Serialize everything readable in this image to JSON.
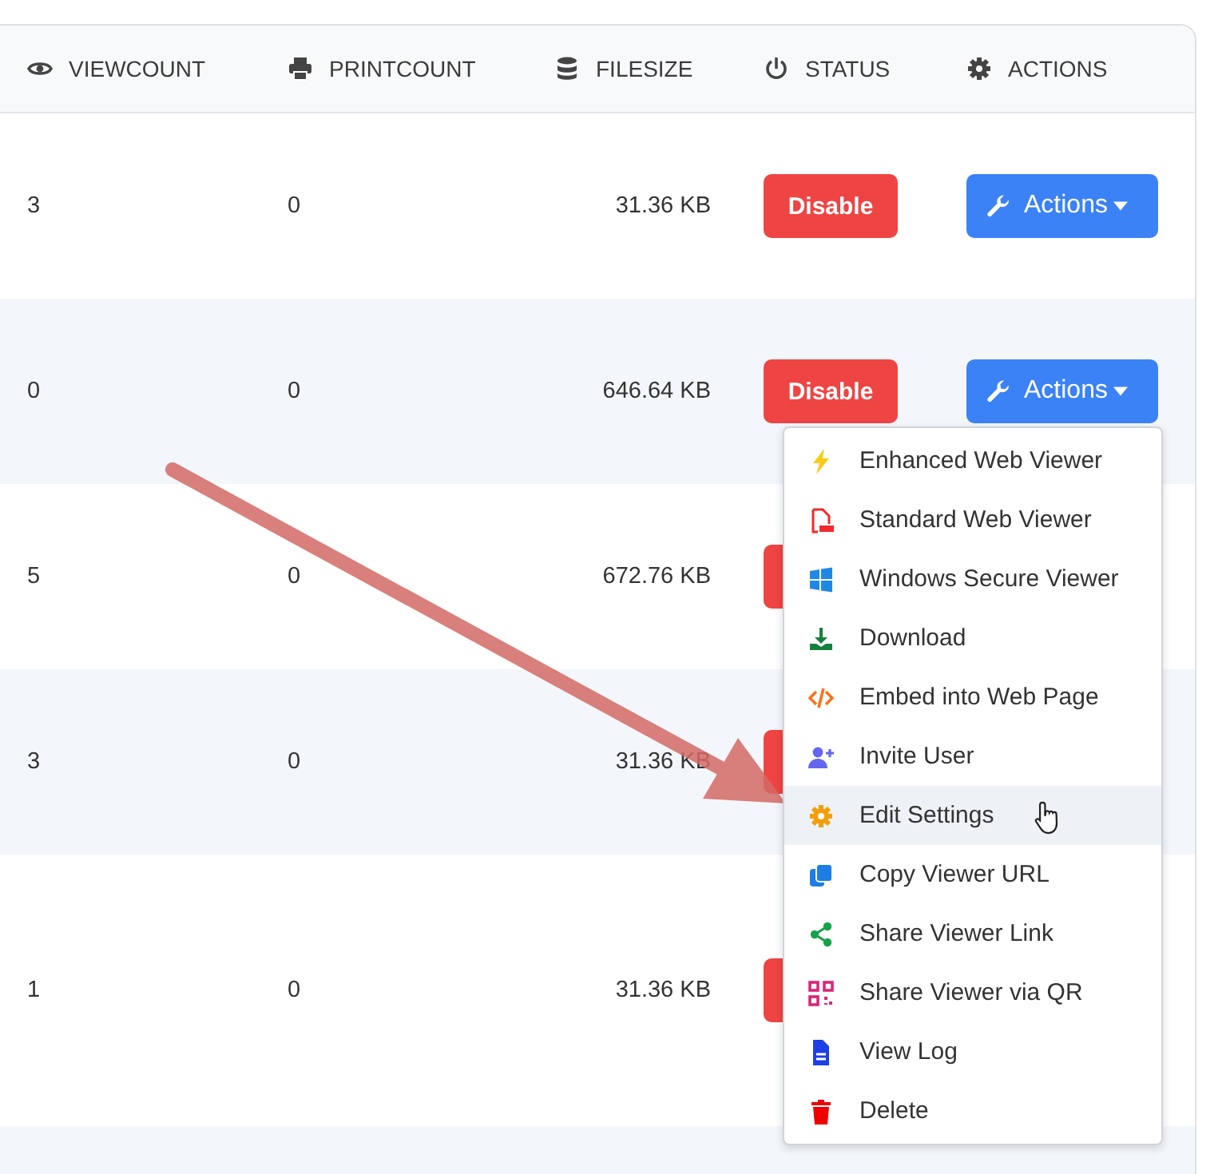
{
  "table": {
    "columns": [
      {
        "label": "VIEWCOUNT"
      },
      {
        "label": "PRINTCOUNT"
      },
      {
        "label": "FILESIZE"
      },
      {
        "label": "STATUS"
      },
      {
        "label": "ACTIONS"
      }
    ],
    "rows": [
      {
        "viewcount": "3",
        "printcount": "0",
        "filesize": "31.36 KB",
        "status": "Disable",
        "actions": "Actions"
      },
      {
        "viewcount": "0",
        "printcount": "0",
        "filesize": "646.64 KB",
        "status": "Disable",
        "actions": "Actions"
      },
      {
        "viewcount": "5",
        "printcount": "0",
        "filesize": "672.76 KB"
      },
      {
        "viewcount": "3",
        "printcount": "0",
        "filesize": "31.36 KB"
      },
      {
        "viewcount": "1",
        "printcount": "0",
        "filesize": "31.36 KB"
      }
    ]
  },
  "actions_menu": {
    "items": [
      {
        "label": "Enhanced Web Viewer",
        "highlighted": false
      },
      {
        "label": "Standard Web Viewer",
        "highlighted": false
      },
      {
        "label": "Windows Secure Viewer",
        "highlighted": false
      },
      {
        "label": "Download",
        "highlighted": false
      },
      {
        "label": "Embed into Web Page",
        "highlighted": false
      },
      {
        "label": "Invite User",
        "highlighted": false
      },
      {
        "label": "Edit Settings",
        "highlighted": true
      },
      {
        "label": "Copy Viewer URL",
        "highlighted": false
      },
      {
        "label": "Share Viewer Link",
        "highlighted": false
      },
      {
        "label": "Share Viewer via QR",
        "highlighted": false
      },
      {
        "label": "View Log",
        "highlighted": false
      },
      {
        "label": "Delete",
        "highlighted": false
      }
    ]
  }
}
